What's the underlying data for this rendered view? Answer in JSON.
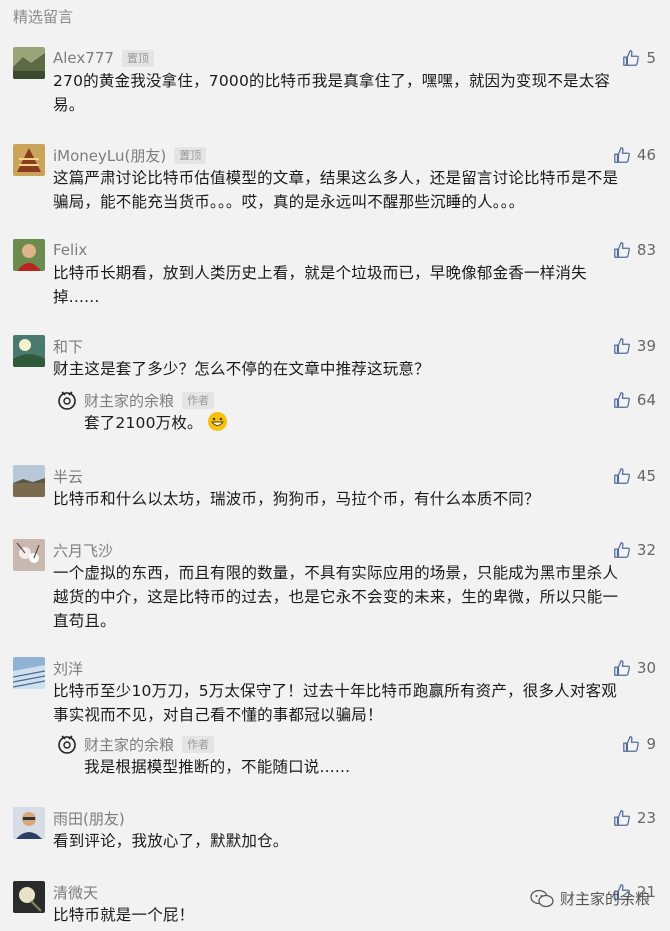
{
  "section_title": "精选留言",
  "comments": [
    {
      "name": "Alex777",
      "badge": "置顶",
      "likes": "5",
      "text_lines": [
        "270的黄金我没拿住，7000的比特币我是真拿住了，嘿嘿，就因为变现不是太容",
        "易。"
      ]
    },
    {
      "name": "iMoneyLu(朋友)",
      "badge": "置顶",
      "likes": "46",
      "text_lines": [
        "这篇严肃讨论比特币估值模型的文章，结果这么多人，还是留言讨论比特币是不是",
        "骗局，能不能充当货币。。。哎，真的是永远叫不醒那些沉睡的人。。。"
      ]
    },
    {
      "name": "Felix",
      "badge": "",
      "likes": "83",
      "text_lines": [
        "比特币长期看，放到人类历史上看，就是个垃圾而已，早晚像郁金香一样消失",
        "掉......"
      ]
    },
    {
      "name": "和下",
      "badge": "",
      "likes": "39",
      "text_lines": [
        "财主这是套了多少？怎么不停的在文章中推荐这玩意？"
      ],
      "reply": {
        "name": "财主家的余粮",
        "badge": "作者",
        "likes": "64",
        "text": "套了2100万枚。"
      }
    },
    {
      "name": "半云",
      "badge": "",
      "likes": "45",
      "text_lines": [
        "比特币和什么以太坊，瑞波币，狗狗币，马拉个币，有什么本质不同？"
      ]
    },
    {
      "name": "六月飞沙",
      "badge": "",
      "likes": "32",
      "text_lines": [
        "一个虚拟的东西，而且有限的数量，不具有实际应用的场景，只能成为黑市里杀人",
        "越货的中介，这是比特币的过去，也是它永不会变的未来，生的卑微，所以只能一",
        "直苟且。"
      ]
    },
    {
      "name": "刘洋",
      "badge": "",
      "likes": "30",
      "text_lines": [
        "比特币至少10万刀，5万太保守了！过去十年比特币跑赢所有资产，很多人对客观",
        "事实视而不见，对自己看不懂的事都冠以骗局！"
      ],
      "reply": {
        "name": "财主家的余粮",
        "badge": "作者",
        "likes": "9",
        "text": "我是根据模型推断的，不能随口说......"
      }
    },
    {
      "name": "雨田(朋友)",
      "badge": "",
      "likes": "23",
      "text_lines": [
        "看到评论，我放心了，默默加仓。"
      ]
    },
    {
      "name": "清微天",
      "badge": "",
      "likes": "21",
      "text_lines": [
        "比特币就是一个屁！"
      ]
    }
  ],
  "watermark": "财主家的余粮",
  "icons": {
    "like": "thumbs-up-icon",
    "author_logo": "author-logo-icon",
    "wechat": "wechat-icon"
  }
}
